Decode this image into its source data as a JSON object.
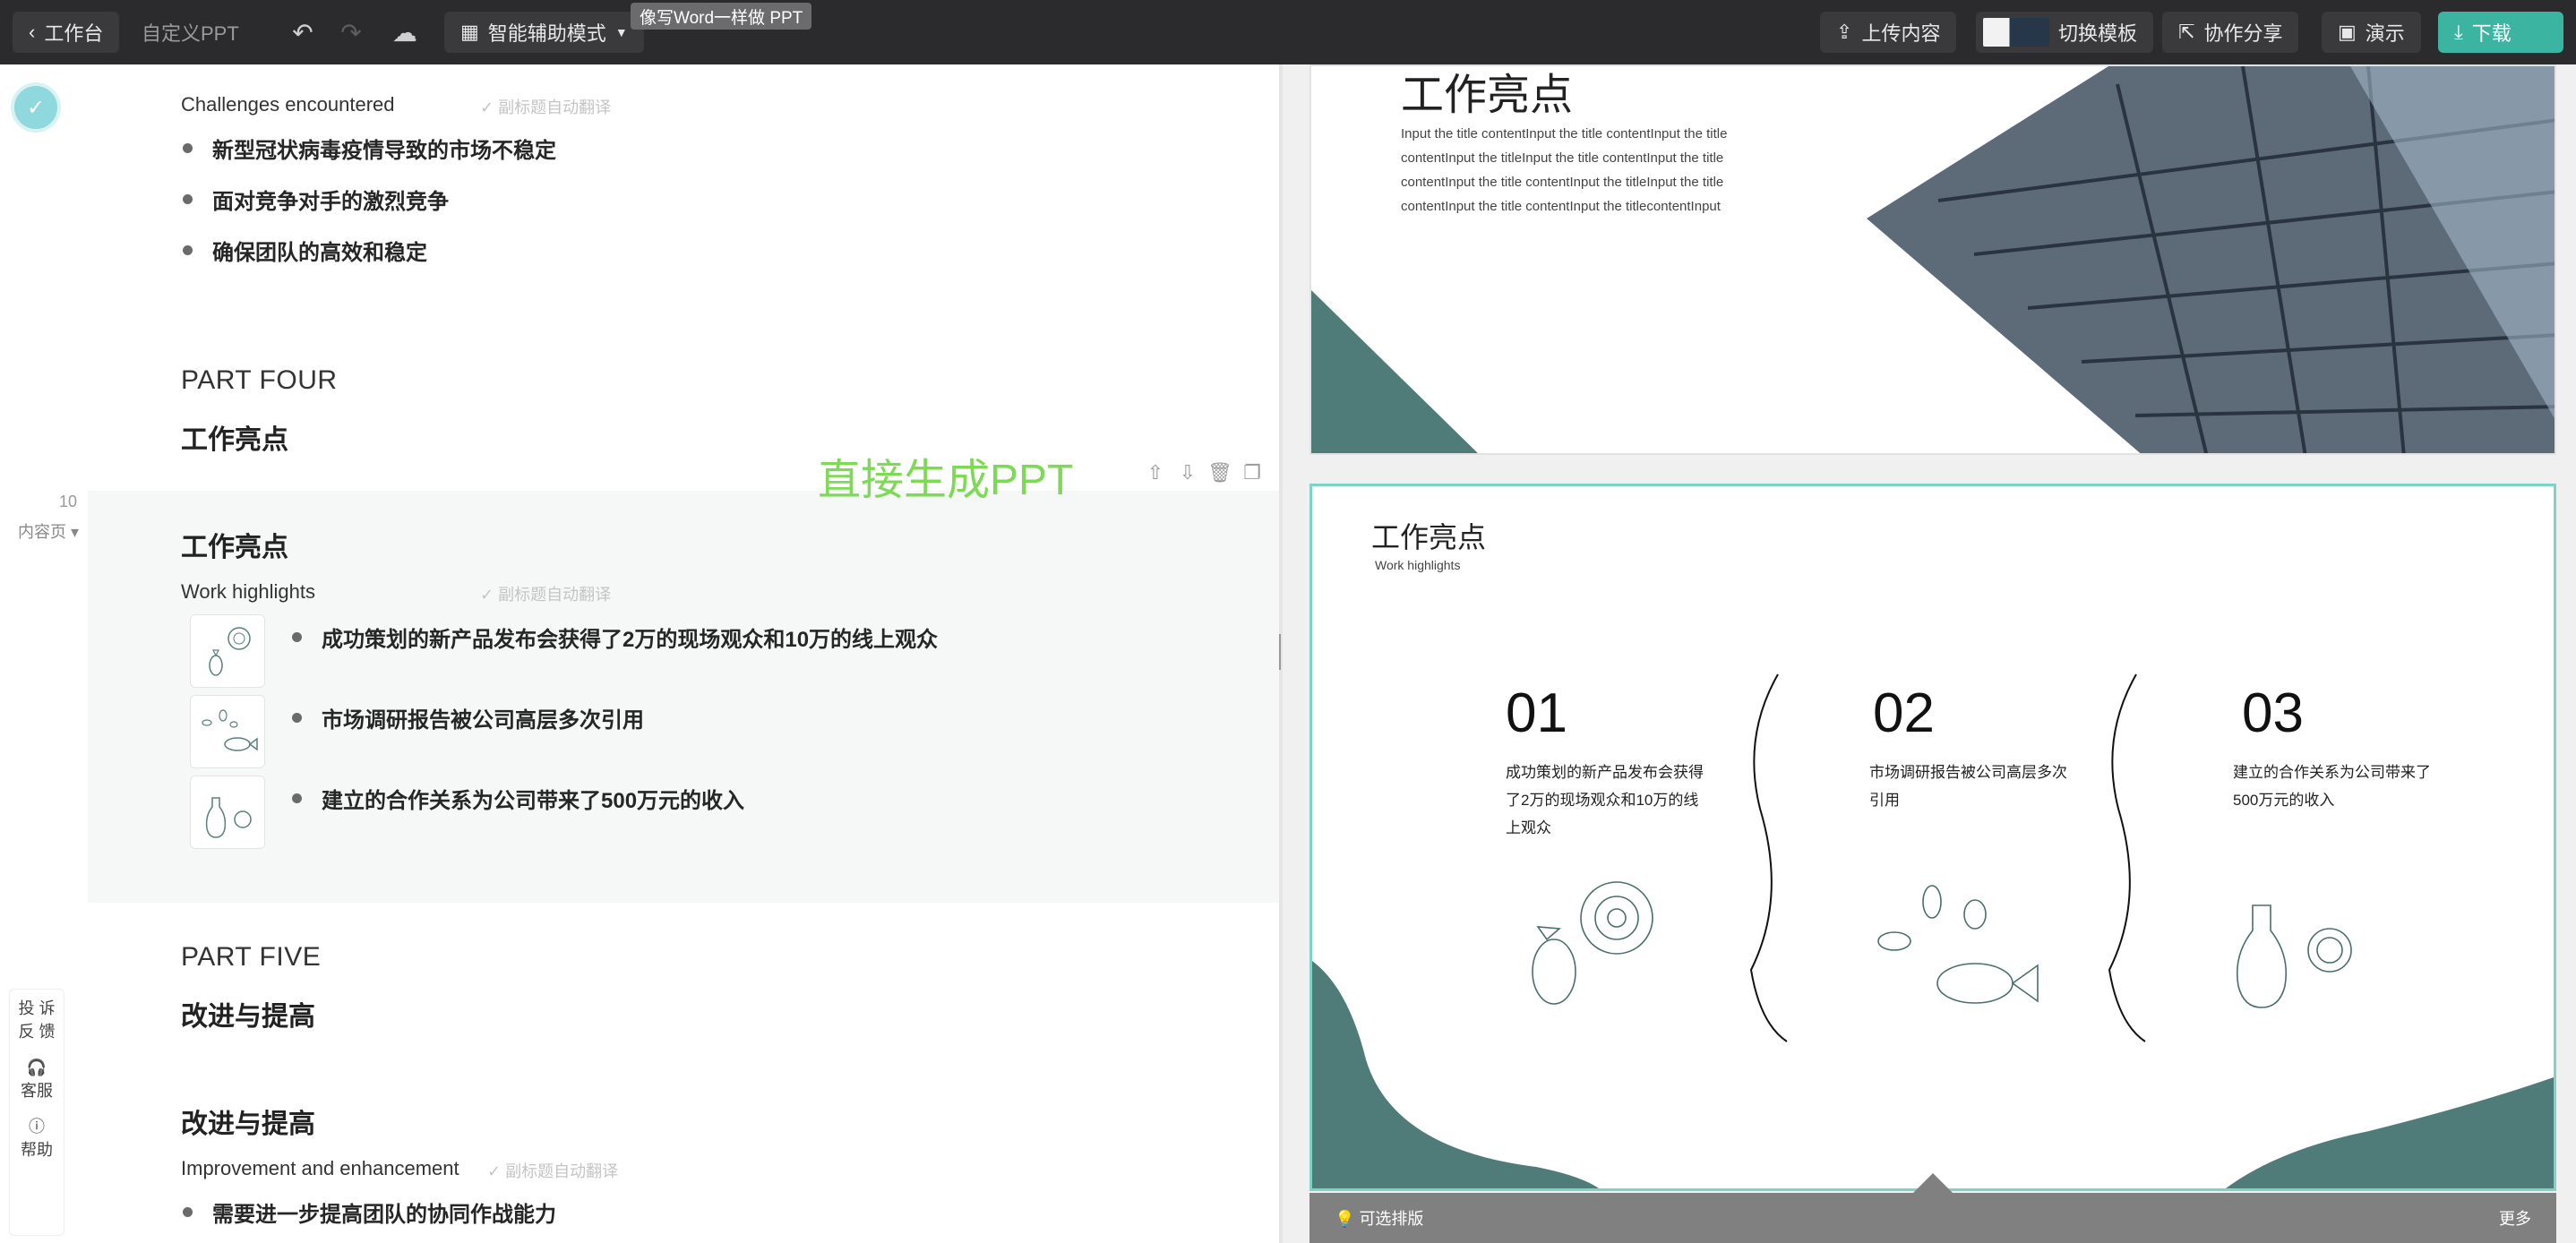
{
  "topbar": {
    "back_label": "工作台",
    "title": "自定义PPT",
    "mode_label": "智能辅助模式",
    "tooltip": "像写Word一样做 PPT",
    "upload_label": "上传内容",
    "switch_template_label": "切换模板",
    "share_label": "协作分享",
    "present_label": "演示",
    "download_label": "下载"
  },
  "editor": {
    "sections": [
      {
        "subtitle_en": "Challenges encountered",
        "auto_translate": "副标题自动翻译",
        "bullets": [
          "新型冠状病毒疫情导致的市场不稳定",
          "面对竞争对手的激烈竞争",
          "确保团队的高效和稳定"
        ]
      }
    ],
    "part_four": {
      "part": "PART FOUR",
      "title": "工作亮点"
    },
    "active_block": {
      "page_number": "10",
      "page_type": "内容页",
      "overlay_text": "直接生成PPT",
      "title": "工作亮点",
      "subtitle_en": "Work highlights",
      "auto_translate": "副标题自动翻译",
      "bullets": [
        "成功策划的新产品发布会获得了2万的现场观众和10万的线上观众",
        "市场调研报告被公司高层多次引用",
        "建立的合作关系为公司带来了500万元的收入"
      ]
    },
    "part_five": {
      "part": "PART FIVE",
      "title": "改进与提高"
    },
    "improve_block": {
      "title": "改进与提高",
      "subtitle_en": "Improvement and enhancement",
      "auto_translate": "副标题自动翻译",
      "bullets": [
        "需要进一步提高团队的协同作战能力"
      ]
    },
    "side": {
      "feedback_line1": "投 诉",
      "feedback_line2": "反 馈",
      "service": "客服",
      "help": "帮助"
    }
  },
  "preview": {
    "slide1": {
      "title": "工作亮点",
      "paragraph": "Input the title contentInput the title contentInput the title contentInput the titleInput the title contentInput the title contentInput the title contentInput the titleInput the title contentInput the title contentInput the titlecontentInput"
    },
    "slide2": {
      "title": "工作亮点",
      "subtitle": "Work highlights",
      "columns": [
        {
          "num": "01",
          "lines": [
            "成功策划的新产品发布会获得",
            "了2万的现场观众和10万的线",
            "上观众"
          ]
        },
        {
          "num": "02",
          "lines": [
            "市场调研报告被公司高层多次",
            "引用"
          ]
        },
        {
          "num": "03",
          "lines": [
            "建立的合作关系为公司带来了",
            "500万元的收入"
          ]
        }
      ]
    },
    "layout_hint": "可选排版",
    "more": "更多"
  },
  "colors": {
    "accent": "#3bb5a2",
    "teal_dark": "#4f7c78",
    "overlay_green": "#7ed957"
  }
}
